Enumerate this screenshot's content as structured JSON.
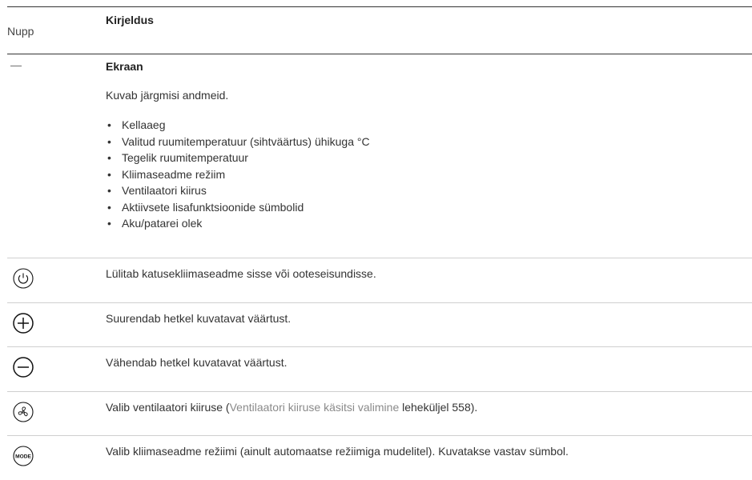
{
  "header": {
    "col1": "Nupp",
    "col2": "Kirjeldus"
  },
  "ekraan": {
    "symbol": "—",
    "title": "Ekraan",
    "description": "Kuvab järgmisi andmeid.",
    "items": [
      "Kellaaeg",
      "Valitud ruumitemperatuur (sihtväärtus) ühikuga °C",
      "Tegelik ruumitemperatuur",
      "Kliimaseadme režiim",
      "Ventilaatori kiirus",
      "Aktiivsete lisafunktsioonide sümbolid",
      "Aku/patarei olek"
    ]
  },
  "rows": [
    {
      "icon": "power-icon",
      "text": "Lülitab katusekliimaseadme sisse või ooteseisundisse."
    },
    {
      "icon": "plus-icon",
      "text": "Suurendab hetkel kuvatavat väärtust."
    },
    {
      "icon": "minus-icon",
      "text": "Vähendab hetkel kuvatavat väärtust."
    },
    {
      "icon": "fan-icon",
      "text_before": "Valib ventilaatori kiiruse (",
      "link": "Ventilaatori kiiruse käsitsi valimine",
      "text_after": " leheküljel 558)."
    },
    {
      "icon": "mode-icon",
      "icon_label": "MODE",
      "text": "Valib kliimaseadme režiimi (ainult automaatse režiimiga mudelitel). Kuvatakse vastav sümbol."
    }
  ]
}
